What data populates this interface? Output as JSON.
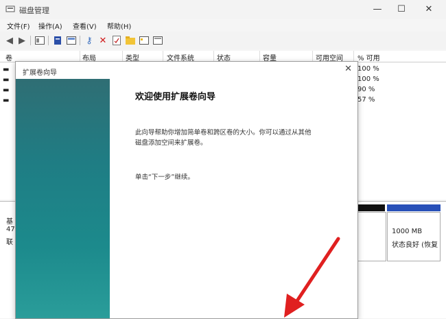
{
  "window": {
    "title": "磁盘管理",
    "minimize": "—",
    "maximize": "☐",
    "close": "✕"
  },
  "menu": [
    {
      "label": "文件(F)"
    },
    {
      "label": "操作(A)"
    },
    {
      "label": "查看(V)"
    },
    {
      "label": "帮助(H)"
    }
  ],
  "table": {
    "columns": [
      "卷",
      "布局",
      "类型",
      "文件系统",
      "状态",
      "容量",
      "可用空间",
      "% 可用"
    ],
    "percent_free": [
      "100 %",
      "100 %",
      "90 %",
      "57 %"
    ]
  },
  "lower": {
    "disk_label_lines": [
      "基",
      "47",
      "联"
    ],
    "partition": {
      "size": "1000 MB",
      "status": "状态良好 (恢复"
    }
  },
  "dialog": {
    "title": "扩展卷向导",
    "close": "✕",
    "heading": "欢迎使用扩展卷向导",
    "description_line1": "此向导帮助你增加简单卷和跨区卷的大小。你可以通过从其他",
    "description_line2": "磁盘添加空间来扩展卷。",
    "instruction": "单击“下一步”继续。"
  },
  "colors": {
    "banner": "#1f7d84",
    "annotation_arrow": "#e02020",
    "disk_bar": "#2850b8"
  }
}
